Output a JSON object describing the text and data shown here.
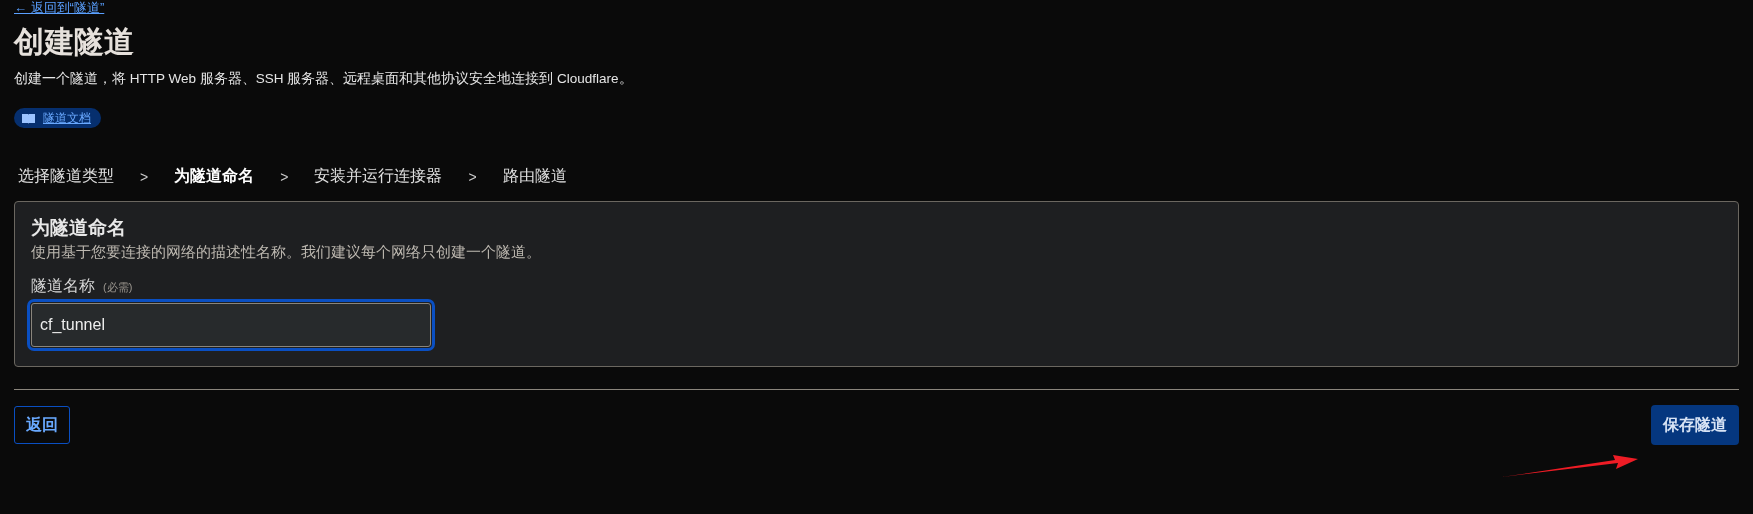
{
  "back_link": "← 返回到“隧道”",
  "title": "创建隧道",
  "description": "创建一个隧道，将 HTTP Web 服务器、SSH 服务器、远程桌面和其他协议安全地连接到 Cloudflare。",
  "docs_badge": {
    "label": "隧道文档"
  },
  "steps": [
    {
      "label": "选择隧道类型",
      "selected": false,
      "separator": ">"
    },
    {
      "label": "为隧道命名",
      "selected": true,
      "separator": ">"
    },
    {
      "label": "安装并运行连接器",
      "selected": false,
      "separator": ">"
    },
    {
      "label": "路由隧道",
      "selected": false
    }
  ],
  "card": {
    "heading": "为隧道命名",
    "hint": "使用基于您要连接的网络的描述性名称。我们建议每个网络只创建一个隧道。",
    "field": {
      "label": "隧道名称",
      "required_note": "(必需)",
      "value": "cf_tunnel",
      "focused": true
    }
  },
  "buttons": {
    "back": "返回",
    "save": "保存隧道"
  }
}
